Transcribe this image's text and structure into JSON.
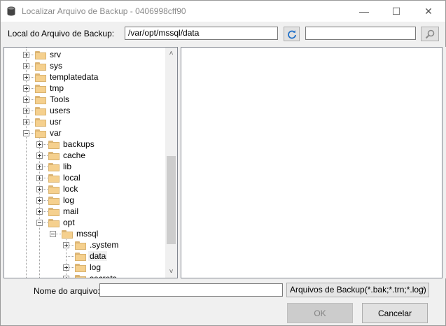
{
  "window": {
    "title": "Localizar Arquivo de Backup - 0406998cff90",
    "minimize_glyph": "—",
    "maximize_glyph": "☐",
    "close_glyph": "✕"
  },
  "location": {
    "label": "Local do Arquivo de Backup:",
    "path": "/var/opt/mssql/data",
    "search_value": ""
  },
  "tree": {
    "items": [
      {
        "label": "srv",
        "level": 1,
        "state": "plus"
      },
      {
        "label": "sys",
        "level": 1,
        "state": "plus"
      },
      {
        "label": "templatedata",
        "level": 1,
        "state": "plus"
      },
      {
        "label": "tmp",
        "level": 1,
        "state": "plus"
      },
      {
        "label": "Tools",
        "level": 1,
        "state": "plus"
      },
      {
        "label": "users",
        "level": 1,
        "state": "plus"
      },
      {
        "label": "usr",
        "level": 1,
        "state": "plus"
      },
      {
        "label": "var",
        "level": 1,
        "state": "minus"
      },
      {
        "label": "backups",
        "level": 2,
        "state": "plus"
      },
      {
        "label": "cache",
        "level": 2,
        "state": "plus"
      },
      {
        "label": "lib",
        "level": 2,
        "state": "plus"
      },
      {
        "label": "local",
        "level": 2,
        "state": "plus"
      },
      {
        "label": "lock",
        "level": 2,
        "state": "plus"
      },
      {
        "label": "log",
        "level": 2,
        "state": "plus"
      },
      {
        "label": "mail",
        "level": 2,
        "state": "plus"
      },
      {
        "label": "opt",
        "level": 2,
        "state": "minus"
      },
      {
        "label": "mssql",
        "level": 3,
        "state": "minus"
      },
      {
        "label": ".system",
        "level": 4,
        "state": "plus"
      },
      {
        "label": "data",
        "level": 4,
        "state": "none",
        "selected": true
      },
      {
        "label": "log",
        "level": 4,
        "state": "plus"
      },
      {
        "label": "secrets",
        "level": 4,
        "state": "plus"
      }
    ],
    "scroll_up_glyph": "˄",
    "scroll_down_glyph": "˅"
  },
  "bottom": {
    "filename_label": "Nome do arquivo:",
    "filename_value": "",
    "filter_selected": "Arquivos de Backup(*.bak;*.trn;*.log)",
    "ok_label": "OK",
    "cancel_label": "Cancelar"
  },
  "colors": {
    "folder": "#f5d08e",
    "refresh_icon": "#1e6fc8",
    "disabled_button": "#cccccc"
  }
}
